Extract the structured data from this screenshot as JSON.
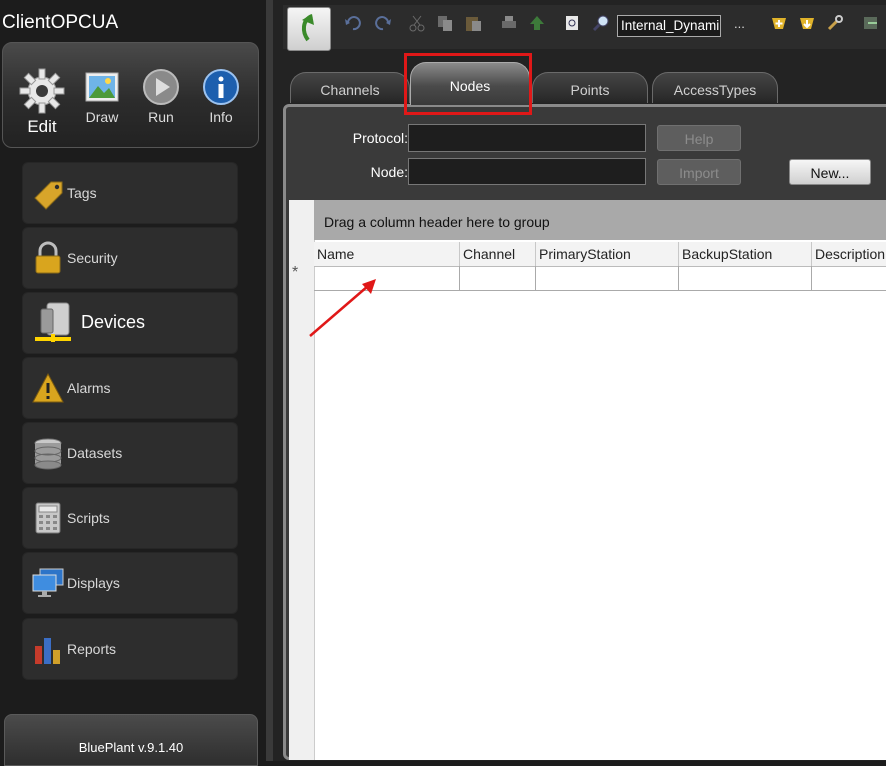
{
  "app": {
    "title": "ClientOPCUA",
    "version": "BluePlant v.9.1.40"
  },
  "modes": [
    {
      "label": "Edit",
      "icon": "gear-icon"
    },
    {
      "label": "Draw",
      "icon": "picture-icon"
    },
    {
      "label": "Run",
      "icon": "play-icon"
    },
    {
      "label": "Info",
      "icon": "info-icon"
    }
  ],
  "sidebar": {
    "items": [
      {
        "label": "Tags",
        "icon": "tag-icon"
      },
      {
        "label": "Security",
        "icon": "padlock-icon"
      },
      {
        "label": "Devices",
        "icon": "device-icon"
      },
      {
        "label": "Alarms",
        "icon": "warning-icon"
      },
      {
        "label": "Datasets",
        "icon": "database-icon"
      },
      {
        "label": "Scripts",
        "icon": "calculator-icon"
      },
      {
        "label": "Displays",
        "icon": "monitor-icon"
      },
      {
        "label": "Reports",
        "icon": "bar-chart-icon"
      }
    ],
    "active": "Devices"
  },
  "toolbar": {
    "search_value": "Internal_Dynami",
    "ellipsis": "..."
  },
  "tabs": [
    {
      "label": "Channels"
    },
    {
      "label": "Nodes"
    },
    {
      "label": "Points"
    },
    {
      "label": "AccessTypes"
    }
  ],
  "active_tab": "Nodes",
  "form": {
    "protocol_label": "Protocol:",
    "node_label": "Node:",
    "help_label": "Help",
    "import_label": "Import",
    "new_label": "New..."
  },
  "grid": {
    "group_hint": "Drag a column header here to group",
    "columns": [
      "Name",
      "Channel",
      "PrimaryStation",
      "BackupStation",
      "Description"
    ],
    "new_row_marker": "*"
  },
  "colors": {
    "highlight": "#e01818",
    "arrow": "#e01818"
  }
}
